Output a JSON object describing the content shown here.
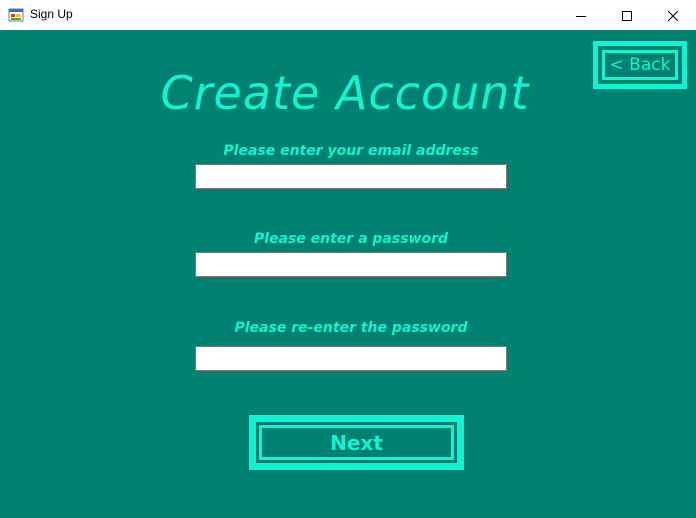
{
  "window": {
    "title": "Sign Up",
    "app_icon": "windows-form-icon",
    "controls": [
      "minimize-icon",
      "maximize-icon",
      "close-icon"
    ]
  },
  "colors": {
    "background": "#008272",
    "accent": "#13f2d2",
    "field_background": "#ffffff"
  },
  "form": {
    "heading": "Create Account",
    "back_label": "< Back",
    "email_label": "Please enter your email address",
    "email_value": "",
    "password_label": "Please enter a password",
    "password_value": "",
    "confirm_label": "Please re-enter the password",
    "confirm_value": "",
    "next_label": "Next"
  }
}
